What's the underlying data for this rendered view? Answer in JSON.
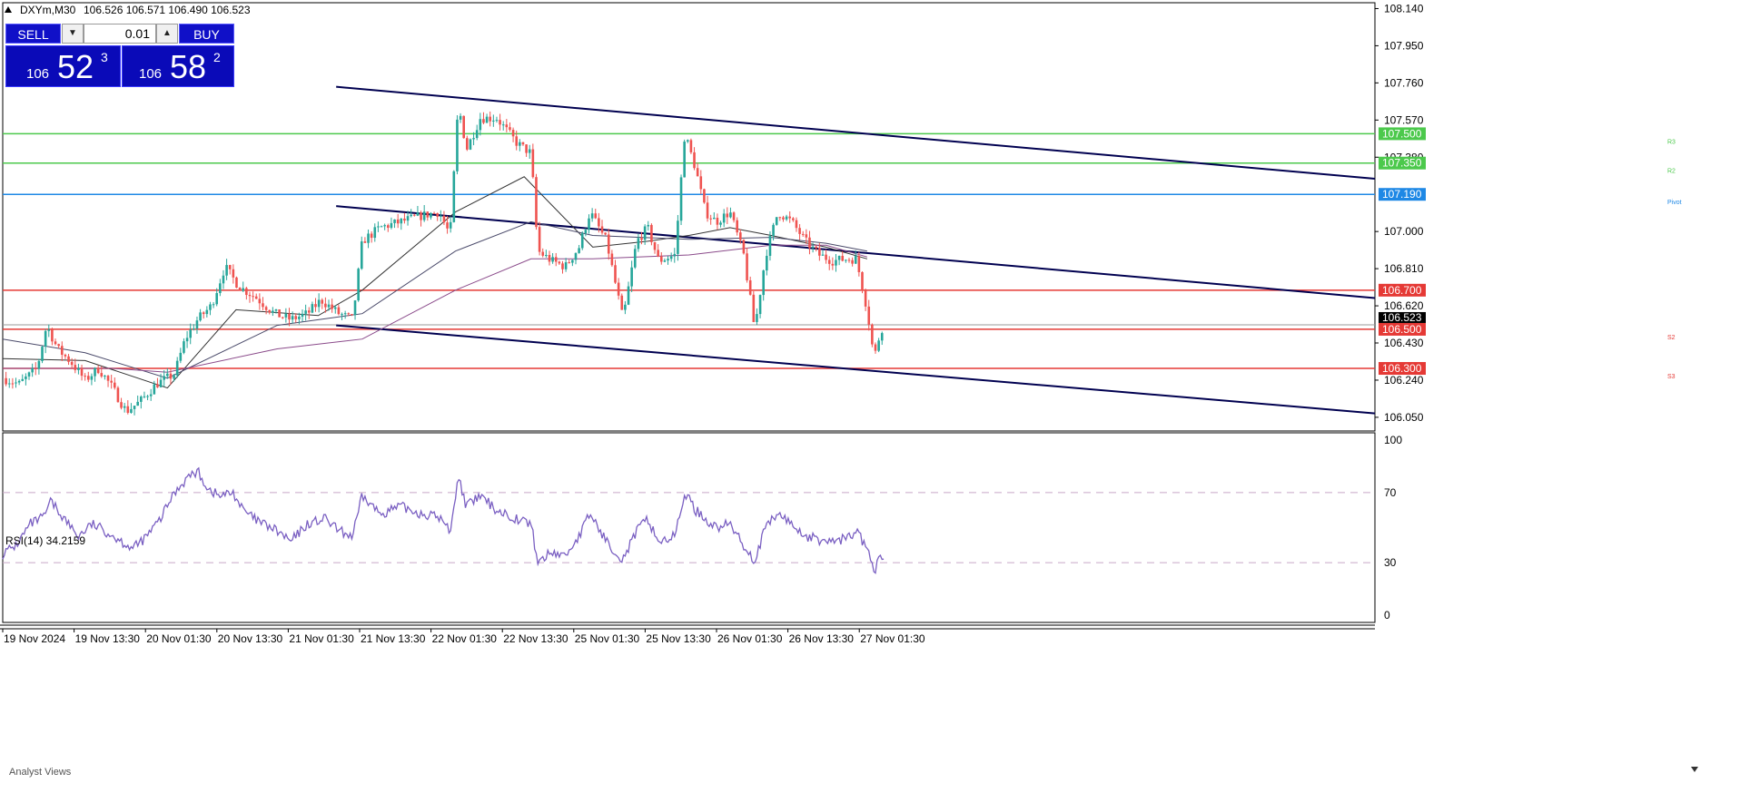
{
  "header": {
    "title": "DXYm,M30",
    "ohlc": "106.526 106.571 106.490 106.523",
    "rsi_label": "RSI(14) 34.2159",
    "analyst_label": "Analyst Views"
  },
  "trade_panel": {
    "sell_label": "SELL",
    "buy_label": "BUY",
    "lot_value": "0.01",
    "bid_small": "106",
    "bid_big": "52",
    "bid_sup": "3",
    "ask_small": "106",
    "ask_big": "58",
    "ask_sup": "2"
  },
  "colors": {
    "bull": "#26a69a",
    "bear": "#ef5350",
    "resistance": "#4cc94c",
    "support": "#e53935",
    "pivot": "#1e88e5",
    "trend": "#000050",
    "rsi": "#7a5fc2",
    "ma_slow": "#333333",
    "ma_mid": "#4a4a6a",
    "ma_long": "#8a4a8a"
  },
  "chart_data": [
    {
      "type": "candlestick",
      "symbol": "DXYm",
      "timeframe": "M30",
      "ylim": [
        105.98,
        108.17
      ],
      "y_ticks": [
        108.14,
        107.95,
        107.76,
        107.57,
        107.38,
        107.0,
        106.81,
        106.62,
        106.43,
        106.24,
        106.05
      ],
      "y_tick_labels": [
        "108.140",
        "107.950",
        "107.760",
        "107.570",
        "107.380",
        "107.000",
        "106.810",
        "106.620",
        "106.430",
        "106.240",
        "106.050"
      ],
      "x_ticks": [
        "19 Nov 2024",
        "19 Nov 13:30",
        "20 Nov 01:30",
        "20 Nov 13:30",
        "21 Nov 01:30",
        "21 Nov 13:30",
        "22 Nov 01:30",
        "22 Nov 13:30",
        "25 Nov 01:30",
        "25 Nov 13:30",
        "26 Nov 01:30",
        "26 Nov 13:30",
        "27 Nov 01:30"
      ],
      "current_price": 106.523,
      "current_price_label": "106.523",
      "levels": [
        {
          "value": 107.5,
          "label": "107.500",
          "tag": "R3",
          "kind": "resistance"
        },
        {
          "value": 107.35,
          "label": "107.350",
          "tag": "R2",
          "kind": "resistance"
        },
        {
          "value": 107.19,
          "label": "107.190",
          "tag": "Pivot",
          "kind": "pivot"
        },
        {
          "value": 106.7,
          "label": "106.700",
          "tag": "",
          "kind": "support"
        },
        {
          "value": 106.5,
          "label": "106.500",
          "tag": "S2",
          "kind": "support"
        },
        {
          "value": 106.3,
          "label": "106.300",
          "tag": "S3",
          "kind": "support"
        }
      ],
      "trend_lines": [
        {
          "from": [
            0.243,
            107.74
          ],
          "to": [
            1.0,
            107.27
          ]
        },
        {
          "from": [
            0.243,
            107.13
          ],
          "to": [
            1.0,
            106.66
          ]
        },
        {
          "from": [
            0.243,
            106.52
          ],
          "to": [
            1.0,
            106.07
          ]
        }
      ],
      "price_path": [
        [
          0.0,
          106.25
        ],
        [
          0.012,
          106.22
        ],
        [
          0.025,
          106.3
        ],
        [
          0.032,
          106.52
        ],
        [
          0.04,
          106.4
        ],
        [
          0.05,
          106.33
        ],
        [
          0.06,
          106.24
        ],
        [
          0.07,
          106.3
        ],
        [
          0.08,
          106.2
        ],
        [
          0.09,
          106.08
        ],
        [
          0.1,
          106.13
        ],
        [
          0.112,
          106.22
        ],
        [
          0.125,
          106.27
        ],
        [
          0.133,
          106.45
        ],
        [
          0.142,
          106.55
        ],
        [
          0.152,
          106.62
        ],
        [
          0.162,
          106.82
        ],
        [
          0.172,
          106.72
        ],
        [
          0.185,
          106.66
        ],
        [
          0.198,
          106.58
        ],
        [
          0.21,
          106.55
        ],
        [
          0.222,
          106.58
        ],
        [
          0.232,
          106.65
        ],
        [
          0.245,
          106.58
        ],
        [
          0.255,
          106.55
        ],
        [
          0.262,
          106.95
        ],
        [
          0.275,
          107.02
        ],
        [
          0.29,
          107.05
        ],
        [
          0.305,
          107.08
        ],
        [
          0.318,
          107.1
        ],
        [
          0.326,
          106.98
        ],
        [
          0.332,
          107.65
        ],
        [
          0.338,
          107.42
        ],
        [
          0.348,
          107.58
        ],
        [
          0.36,
          107.58
        ],
        [
          0.375,
          107.45
        ],
        [
          0.385,
          107.4
        ],
        [
          0.39,
          106.9
        ],
        [
          0.4,
          106.85
        ],
        [
          0.41,
          106.82
        ],
        [
          0.42,
          106.92
        ],
        [
          0.428,
          107.1
        ],
        [
          0.44,
          106.95
        ],
        [
          0.452,
          106.55
        ],
        [
          0.462,
          106.95
        ],
        [
          0.47,
          107.02
        ],
        [
          0.478,
          106.85
        ],
        [
          0.49,
          106.88
        ],
        [
          0.497,
          107.5
        ],
        [
          0.505,
          107.32
        ],
        [
          0.512,
          107.1
        ],
        [
          0.52,
          107.05
        ],
        [
          0.53,
          107.1
        ],
        [
          0.54,
          106.88
        ],
        [
          0.548,
          106.5
        ],
        [
          0.556,
          106.88
        ],
        [
          0.565,
          107.1
        ],
        [
          0.575,
          107.05
        ],
        [
          0.585,
          106.95
        ],
        [
          0.595,
          106.88
        ],
        [
          0.605,
          106.85
        ],
        [
          0.615,
          106.86
        ],
        [
          0.622,
          106.86
        ],
        [
          0.63,
          106.6
        ],
        [
          0.635,
          106.35
        ],
        [
          0.64,
          106.5
        ],
        [
          0.643,
          106.52
        ]
      ],
      "moving_averages": [
        {
          "name": "ma_fast",
          "points": [
            [
              0.0,
              106.35
            ],
            [
              0.06,
              106.34
            ],
            [
              0.12,
              106.2
            ],
            [
              0.17,
              106.6
            ],
            [
              0.23,
              106.57
            ],
            [
              0.262,
              106.7
            ],
            [
              0.33,
              107.1
            ],
            [
              0.38,
              107.28
            ],
            [
              0.43,
              106.92
            ],
            [
              0.47,
              106.95
            ],
            [
              0.5,
              106.98
            ],
            [
              0.53,
              107.02
            ],
            [
              0.56,
              106.98
            ],
            [
              0.6,
              106.92
            ],
            [
              0.63,
              106.86
            ]
          ]
        },
        {
          "name": "ma_mid",
          "points": [
            [
              0.0,
              106.45
            ],
            [
              0.06,
              106.38
            ],
            [
              0.12,
              106.25
            ],
            [
              0.2,
              106.52
            ],
            [
              0.262,
              106.58
            ],
            [
              0.33,
              106.9
            ],
            [
              0.385,
              107.05
            ],
            [
              0.43,
              106.98
            ],
            [
              0.5,
              106.96
            ],
            [
              0.56,
              106.97
            ],
            [
              0.6,
              106.94
            ],
            [
              0.63,
              106.9
            ]
          ]
        },
        {
          "name": "ma_long",
          "points": [
            [
              0.0,
              106.3
            ],
            [
              0.08,
              106.3
            ],
            [
              0.12,
              106.28
            ],
            [
              0.2,
              106.4
            ],
            [
              0.262,
              106.45
            ],
            [
              0.33,
              106.7
            ],
            [
              0.385,
              106.86
            ],
            [
              0.43,
              106.86
            ],
            [
              0.5,
              106.88
            ],
            [
              0.56,
              106.93
            ],
            [
              0.6,
              106.93
            ],
            [
              0.63,
              106.87
            ]
          ]
        }
      ]
    },
    {
      "type": "line",
      "name": "RSI(14)",
      "ylim": [
        0,
        100
      ],
      "y_ticks": [
        100,
        70,
        30,
        0
      ],
      "y_tick_labels": [
        "100",
        "70",
        "30",
        "0"
      ],
      "levels": [
        70,
        30
      ],
      "points": [
        [
          0.0,
          35
        ],
        [
          0.01,
          40
        ],
        [
          0.02,
          52
        ],
        [
          0.03,
          56
        ],
        [
          0.035,
          65
        ],
        [
          0.045,
          55
        ],
        [
          0.055,
          45
        ],
        [
          0.065,
          52
        ],
        [
          0.075,
          48
        ],
        [
          0.085,
          43
        ],
        [
          0.095,
          38
        ],
        [
          0.105,
          45
        ],
        [
          0.115,
          55
        ],
        [
          0.125,
          70
        ],
        [
          0.135,
          79
        ],
        [
          0.142,
          82
        ],
        [
          0.15,
          72
        ],
        [
          0.158,
          68
        ],
        [
          0.168,
          70
        ],
        [
          0.175,
          60
        ],
        [
          0.185,
          54
        ],
        [
          0.2,
          48
        ],
        [
          0.21,
          42
        ],
        [
          0.222,
          52
        ],
        [
          0.235,
          55
        ],
        [
          0.245,
          48
        ],
        [
          0.255,
          45
        ],
        [
          0.262,
          68
        ],
        [
          0.275,
          58
        ],
        [
          0.29,
          62
        ],
        [
          0.305,
          58
        ],
        [
          0.318,
          56
        ],
        [
          0.326,
          48
        ],
        [
          0.332,
          79
        ],
        [
          0.338,
          62
        ],
        [
          0.348,
          68
        ],
        [
          0.36,
          60
        ],
        [
          0.375,
          55
        ],
        [
          0.385,
          52
        ],
        [
          0.39,
          30
        ],
        [
          0.4,
          36
        ],
        [
          0.41,
          34
        ],
        [
          0.42,
          45
        ],
        [
          0.428,
          58
        ],
        [
          0.44,
          42
        ],
        [
          0.452,
          32
        ],
        [
          0.462,
          48
        ],
        [
          0.47,
          55
        ],
        [
          0.478,
          42
        ],
        [
          0.49,
          45
        ],
        [
          0.497,
          70
        ],
        [
          0.505,
          60
        ],
        [
          0.512,
          55
        ],
        [
          0.52,
          50
        ],
        [
          0.53,
          52
        ],
        [
          0.54,
          40
        ],
        [
          0.548,
          31
        ],
        [
          0.556,
          50
        ],
        [
          0.565,
          58
        ],
        [
          0.575,
          52
        ],
        [
          0.585,
          45
        ],
        [
          0.595,
          43
        ],
        [
          0.605,
          42
        ],
        [
          0.615,
          44
        ],
        [
          0.622,
          48
        ],
        [
          0.63,
          38
        ],
        [
          0.635,
          24
        ],
        [
          0.64,
          34
        ],
        [
          0.643,
          34
        ]
      ]
    }
  ]
}
